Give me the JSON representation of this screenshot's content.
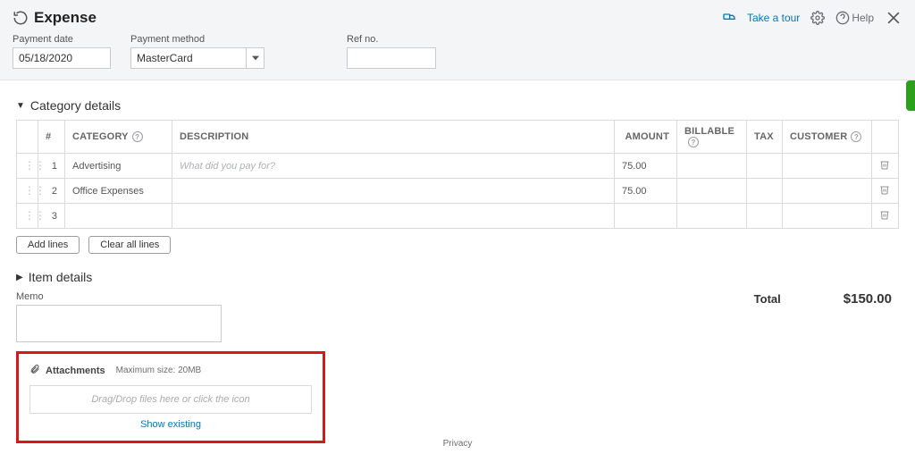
{
  "header": {
    "title": "Expense",
    "tour_link": "Take a tour",
    "help_label": "Help"
  },
  "fields": {
    "payment_date": {
      "label": "Payment date",
      "value": "05/18/2020"
    },
    "payment_method": {
      "label": "Payment method",
      "value": "MasterCard"
    },
    "ref_no": {
      "label": "Ref no.",
      "value": ""
    }
  },
  "sections": {
    "category_title": "Category details",
    "item_title": "Item details"
  },
  "table": {
    "headers": {
      "num": "#",
      "category": "CATEGORY",
      "description": "DESCRIPTION",
      "amount": "AMOUNT",
      "billable": "BILLABLE",
      "tax": "TAX",
      "customer": "CUSTOMER"
    },
    "rows": [
      {
        "num": "1",
        "category": "Advertising",
        "description": "",
        "description_placeholder": "What did you pay for?",
        "amount": "75.00"
      },
      {
        "num": "2",
        "category": "Office Expenses",
        "description": "",
        "description_placeholder": "",
        "amount": "75.00"
      },
      {
        "num": "3",
        "category": "",
        "description": "",
        "description_placeholder": "",
        "amount": ""
      }
    ],
    "add_lines": "Add lines",
    "clear_lines": "Clear all lines"
  },
  "memo": {
    "label": "Memo",
    "value": ""
  },
  "total": {
    "label": "Total",
    "value": "$150.00"
  },
  "attachments": {
    "title": "Attachments",
    "max_size": "Maximum size: 20MB",
    "drop_hint": "Drag/Drop files here or click the icon",
    "show_existing": "Show existing"
  },
  "footer": {
    "privacy": "Privacy"
  }
}
